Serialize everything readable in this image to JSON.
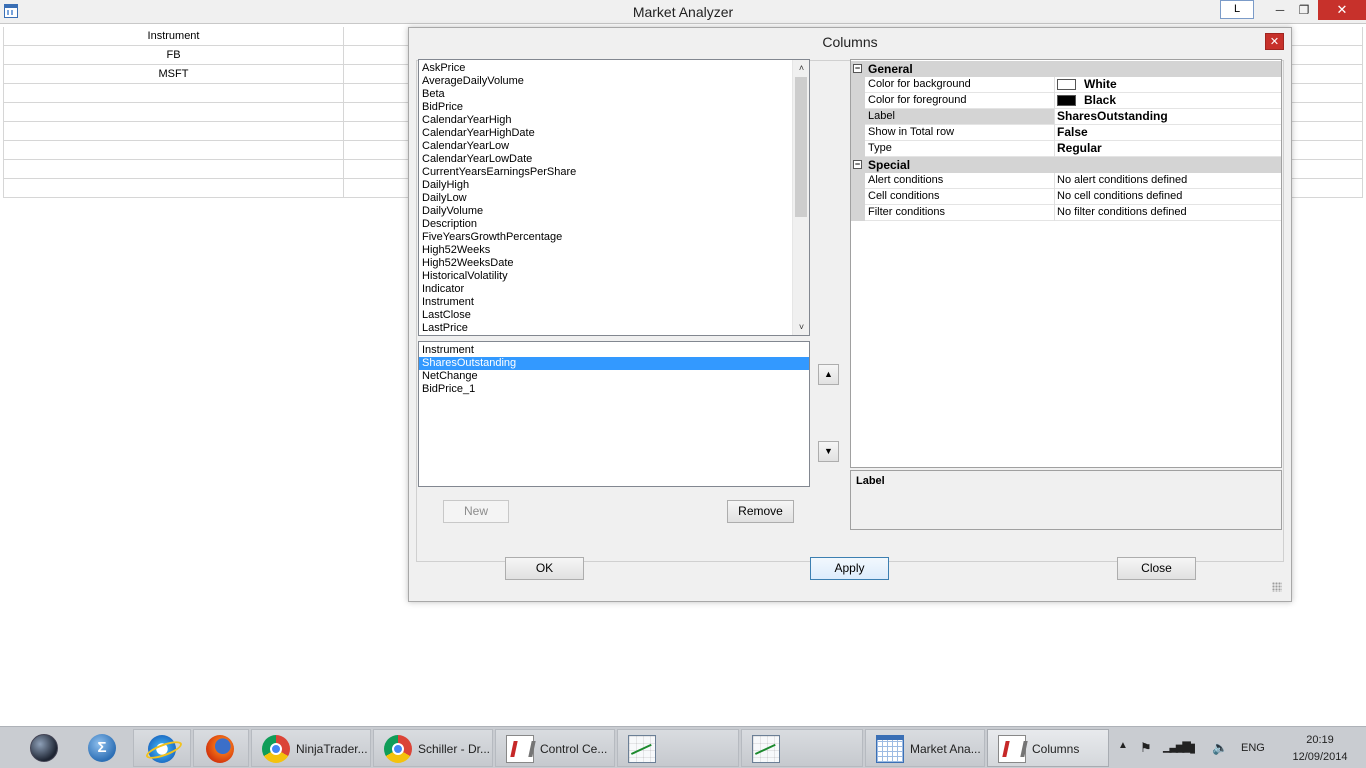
{
  "window": {
    "title": "Market Analyzer",
    "link_button": "L",
    "min_glyph": "─",
    "max_glyph": "❐",
    "close_glyph": "✕"
  },
  "grid": {
    "header": "Instrument",
    "rows": [
      "FB",
      "MSFT"
    ]
  },
  "dialog": {
    "title": "Columns",
    "close_glyph": "✕",
    "available_columns": [
      "AskPrice",
      "AverageDailyVolume",
      "Beta",
      "BidPrice",
      "CalendarYearHigh",
      "CalendarYearHighDate",
      "CalendarYearLow",
      "CalendarYearLowDate",
      "CurrentYearsEarningsPerShare",
      "DailyHigh",
      "DailyLow",
      "DailyVolume",
      "Description",
      "FiveYearsGrowthPercentage",
      "High52Weeks",
      "High52WeeksDate",
      "HistoricalVolatility",
      "Indicator",
      "Instrument",
      "LastClose",
      "LastPrice"
    ],
    "selected_columns": [
      "Instrument",
      "SharesOutstanding",
      "NetChange",
      "BidPrice_1"
    ],
    "selected_index": 1,
    "buttons": {
      "new": "New",
      "remove": "Remove",
      "up_glyph": "▲",
      "down_glyph": "▼",
      "ok": "OK",
      "apply": "Apply",
      "close": "Close"
    },
    "properties": {
      "general": {
        "label": "General",
        "rows": [
          {
            "key": "Color for background",
            "value": "White",
            "swatch": "#ffffff"
          },
          {
            "key": "Color for foreground",
            "value": "Black",
            "swatch": "#000000"
          },
          {
            "key": "Label",
            "value": "SharesOutstanding"
          },
          {
            "key": "Show in Total row",
            "value": "False"
          },
          {
            "key": "Type",
            "value": "Regular"
          }
        ]
      },
      "special": {
        "label": "Special",
        "rows": [
          {
            "key": "Alert conditions",
            "value": "No alert conditions defined"
          },
          {
            "key": "Cell conditions",
            "value": "No cell conditions defined"
          },
          {
            "key": "Filter conditions",
            "value": "No filter conditions defined"
          }
        ]
      },
      "collapse_glyph": "−",
      "description_title": "Label"
    }
  },
  "taskbar": {
    "items": [
      {
        "icon": "globe-icon",
        "label": ""
      },
      {
        "icon": "sigma-icon",
        "label": ""
      },
      {
        "icon": "internet-explorer-icon",
        "label": ""
      },
      {
        "icon": "firefox-icon",
        "label": ""
      },
      {
        "icon": "chrome-icon",
        "label": "NinjaTrader..."
      },
      {
        "icon": "chrome-icon",
        "label": "Schiller - Dr..."
      },
      {
        "icon": "ninjatrader-icon",
        "label": "Control Ce..."
      },
      {
        "icon": "chart-icon",
        "label": ""
      },
      {
        "icon": "chart-icon",
        "label": ""
      },
      {
        "icon": "market-analyzer-icon",
        "label": "Market Ana..."
      },
      {
        "icon": "ninjatrader-icon",
        "label": "Columns"
      }
    ],
    "tray": {
      "language": "ENG",
      "time": "20:19",
      "date": "12/09/2014"
    }
  }
}
